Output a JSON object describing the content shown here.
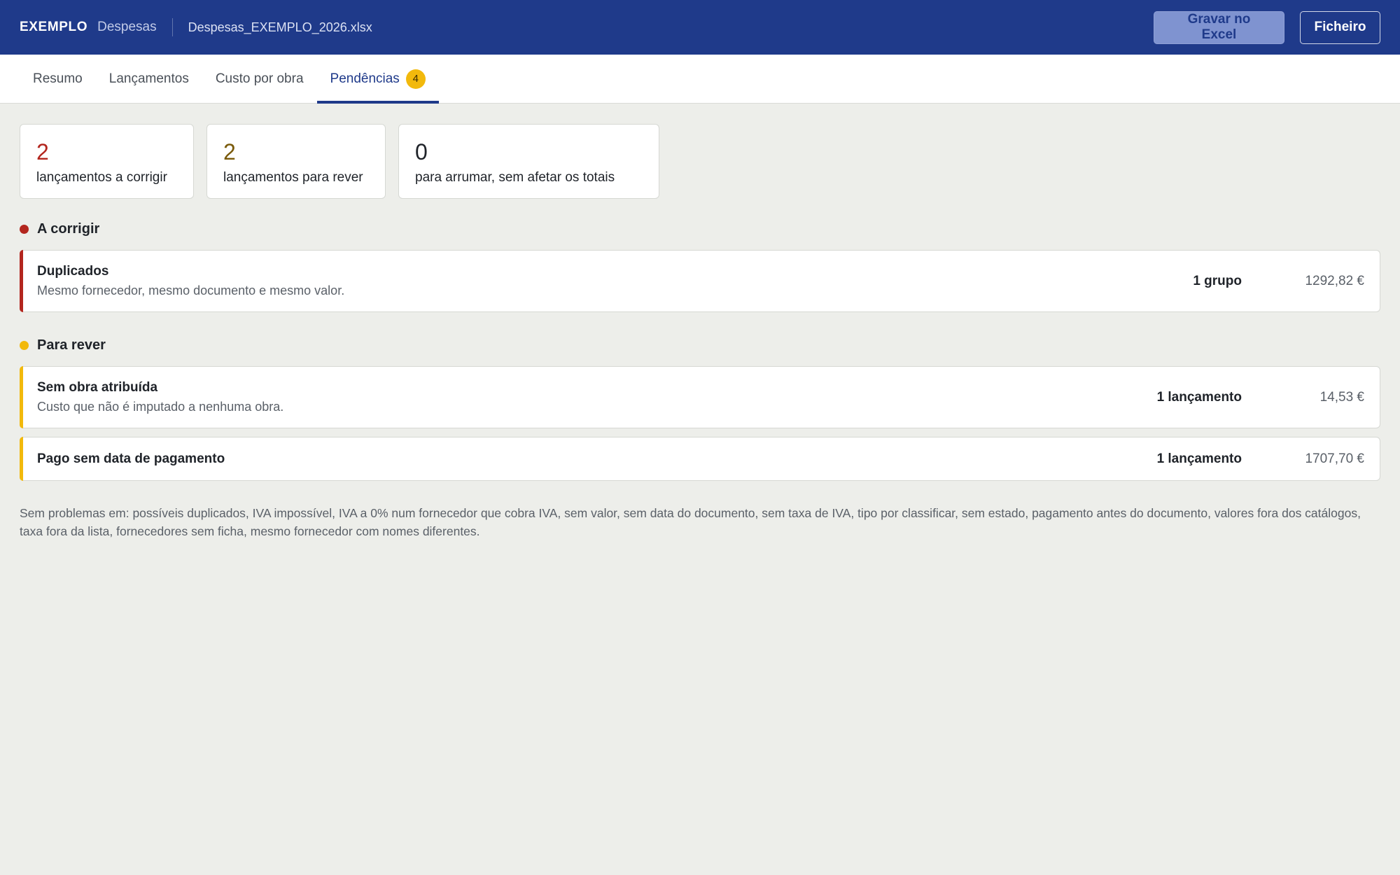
{
  "header": {
    "brand": "EXEMPLO",
    "app_name": "Despesas",
    "filename": "Despesas_EXEMPLO_2026.xlsx",
    "save_button": "Gravar no Excel",
    "file_button": "Ficheiro"
  },
  "tabs": [
    {
      "label": "Resumo"
    },
    {
      "label": "Lançamentos"
    },
    {
      "label": "Custo por obra"
    },
    {
      "label": "Pendências",
      "badge": "4",
      "active": true
    }
  ],
  "stats": [
    {
      "value": "2",
      "label": "lançamentos a corrigir",
      "color": "#b3261e"
    },
    {
      "value": "2",
      "label": "lançamentos para rever",
      "color": "#7a5a0a"
    },
    {
      "value": "0",
      "label": "para arrumar, sem afetar os totais",
      "color": "#1f2329"
    }
  ],
  "sections": {
    "fix": {
      "title": "A corrigir",
      "color": "#b3261e",
      "items": [
        {
          "title": "Duplicados",
          "desc": "Mesmo fornecedor, mesmo documento e mesmo valor.",
          "count": "1 grupo",
          "amount": "1292,82 €"
        }
      ]
    },
    "review": {
      "title": "Para rever",
      "color": "#f2b90c",
      "items": [
        {
          "title": "Sem obra atribuída",
          "desc": "Custo que não é imputado a nenhuma obra.",
          "count": "1 lançamento",
          "amount": "14,53 €"
        },
        {
          "title": "Pago sem data de pagamento",
          "count": "1 lançamento",
          "amount": "1707,70 €"
        }
      ]
    }
  },
  "footnote": "Sem problemas em: possíveis duplicados, IVA impossível, IVA a 0% num fornecedor que cobra IVA, sem valor, sem data do documento, sem taxa de IVA, tipo por classificar, sem estado, pagamento antes do documento, valores fora dos catálogos, taxa fora da lista, fornecedores sem ficha, mesmo fornecedor com nomes diferentes."
}
